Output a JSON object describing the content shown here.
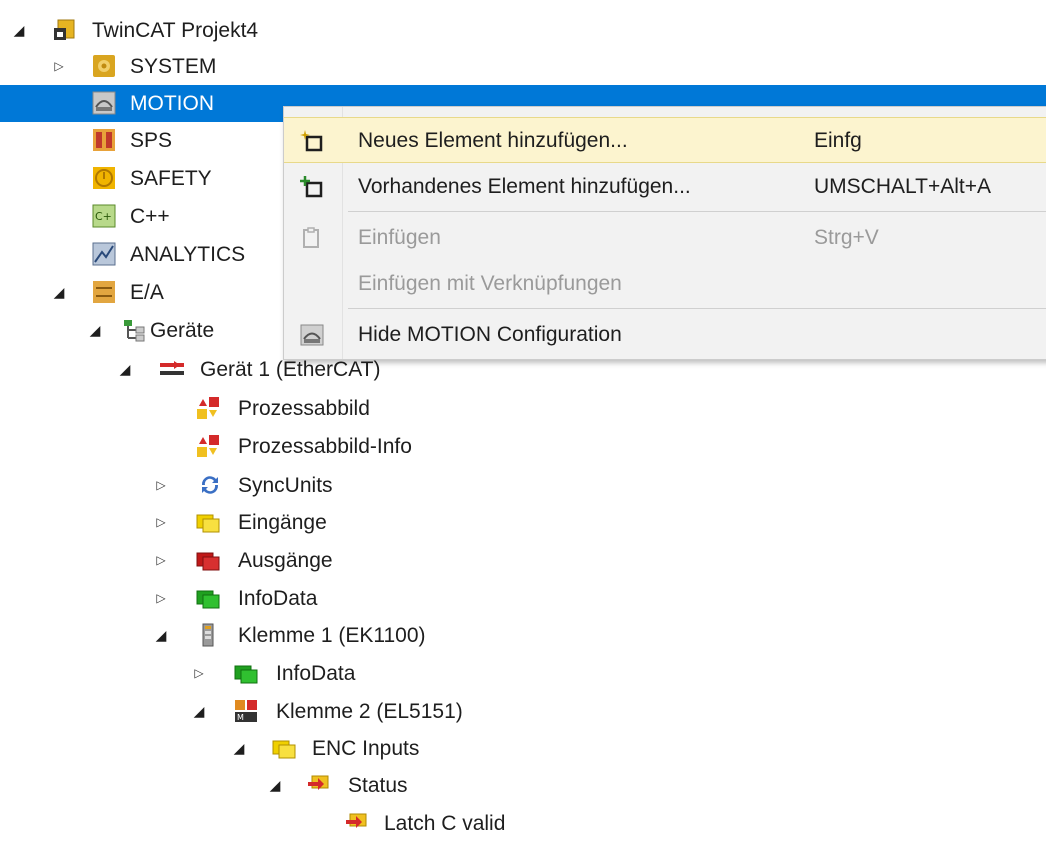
{
  "tree": {
    "root": "TwinCAT Projekt4",
    "system": "SYSTEM",
    "motion": "MOTION",
    "sps": "SPS",
    "safety": "SAFETY",
    "cpp": "C++",
    "analytics": "ANALYTICS",
    "ea": "E/A",
    "geraete": "Geräte",
    "geraet1": "Gerät 1 (EtherCAT)",
    "prozessabbild": "Prozessabbild",
    "prozessabbild_info": "Prozessabbild-Info",
    "syncunits": "SyncUnits",
    "eingaenge": "Eingänge",
    "ausgaenge": "Ausgänge",
    "infodata": "InfoData",
    "klemme1": "Klemme 1 (EK1100)",
    "infodata2": "InfoData",
    "klemme2": "Klemme 2 (EL5151)",
    "enc_inputs": "ENC Inputs",
    "status": "Status",
    "latch": "Latch C valid"
  },
  "menu": {
    "items": [
      {
        "label": "Neues Element hinzufügen...",
        "shortcut": "Einfg",
        "icon": "new-element-icon",
        "enabled": true
      },
      {
        "label": "Vorhandenes Element hinzufügen...",
        "shortcut": "UMSCHALT+Alt+A",
        "icon": "existing-element-icon",
        "enabled": true
      },
      {
        "label": "Einfügen",
        "shortcut": "Strg+V",
        "icon": "paste-icon",
        "enabled": false
      },
      {
        "label": "Einfügen mit Verknüpfungen",
        "shortcut": "",
        "icon": "",
        "enabled": false
      },
      {
        "label": "Hide MOTION Configuration",
        "shortcut": "",
        "icon": "motion-icon",
        "enabled": true
      }
    ]
  },
  "colors": {
    "selection": "#0078d7",
    "menu_highlight": "#fcf4cf"
  }
}
